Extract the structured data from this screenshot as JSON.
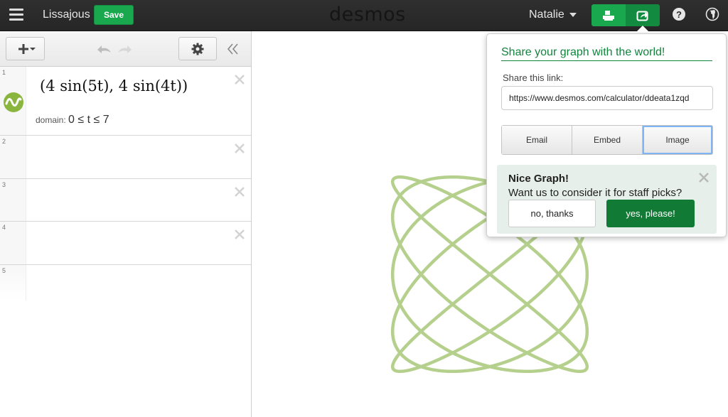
{
  "header": {
    "menu_icon": "hamburger-icon",
    "title": "Lissajous",
    "save_label": "Save",
    "logo": "desmos",
    "user_name": "Natalie",
    "print_icon": "print-icon",
    "share_icon": "share-icon",
    "help_icon": "help-icon",
    "language_icon": "globe-icon"
  },
  "toolbar": {
    "add_icon": "plus-icon",
    "undo_icon": "undo-icon",
    "redo_icon": "redo-icon",
    "settings_icon": "gear-icon",
    "collapse_icon": "double-chevron-left-icon"
  },
  "expressions": [
    {
      "index": "1",
      "latex": "(4 sin(5t), 4 sin(4t))",
      "domain_label": "domain:",
      "domain_value": "0 ≤ t ≤ 7",
      "color": "#9cc26a"
    },
    {
      "index": "2"
    },
    {
      "index": "3"
    },
    {
      "index": "4"
    },
    {
      "index": "5"
    }
  ],
  "share": {
    "heading": "Share your graph with the world!",
    "link_label": "Share this link:",
    "link_value": "https://www.desmos.com/calculator/ddeata1zqd",
    "options": [
      "Email",
      "Embed",
      "Image"
    ],
    "staff_title": "Nice Graph!",
    "staff_question": "Want us to consider it for staff picks?",
    "no_label": "no, thanks",
    "yes_label": "yes, please!"
  },
  "colors": {
    "brand_green": "#1aa84f",
    "curve": "#b5d08d"
  },
  "graph": {
    "x_expr": "4 sin(5t)",
    "y_expr": "4 sin(4t)",
    "t_min": 0,
    "t_max": 7,
    "amplitude": 4
  }
}
